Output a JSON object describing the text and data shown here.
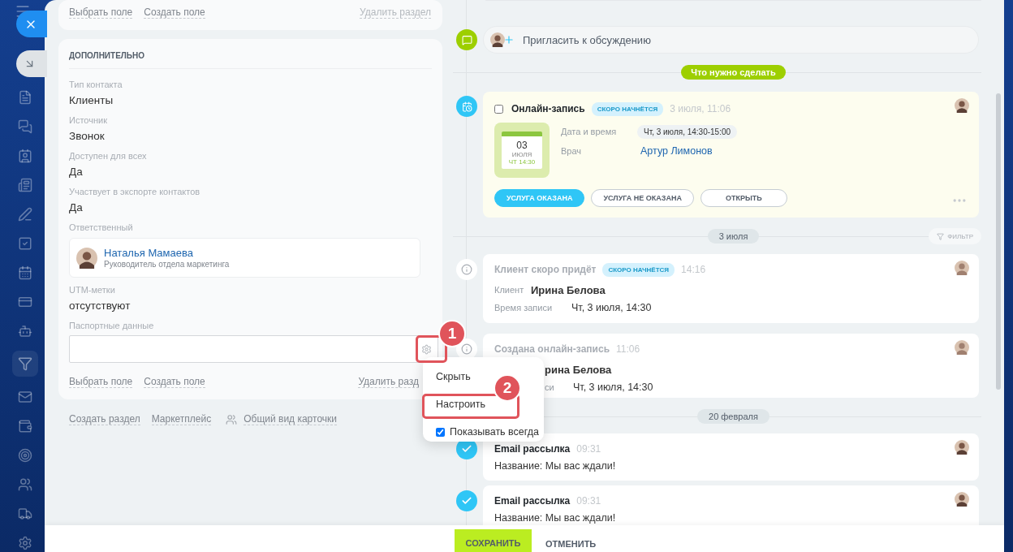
{
  "top_section": {
    "links": [
      "Выбрать поле",
      "Создать поле"
    ],
    "delete_link": "Удалить раздел"
  },
  "section": {
    "title": "ДОПОЛНИТЕЛЬНО",
    "fields": [
      {
        "kind": "text",
        "label": "Тип контакта",
        "value": "Клиенты"
      },
      {
        "kind": "text",
        "label": "Источник",
        "value": "Звонок"
      },
      {
        "kind": "text",
        "label": "Доступен для всех",
        "value": "Да"
      },
      {
        "kind": "text",
        "label": "Участвует в экспорте контактов",
        "value": "Да"
      },
      {
        "kind": "person",
        "label": "Ответственный",
        "name": "Наталья Мамаева",
        "position": "Руководитель отдела маркетинга"
      },
      {
        "kind": "text",
        "label": "UTM-метки",
        "value": "отсутствуют"
      },
      {
        "kind": "input",
        "label": "Паспортные данные"
      }
    ],
    "links": [
      "Выбрать поле",
      "Создать поле"
    ],
    "delete_link": "Удалить разд"
  },
  "footer_links": [
    {
      "kind": "link",
      "label": "Создать раздел"
    },
    {
      "kind": "link",
      "label": "Маркетплейс"
    },
    {
      "kind": "view",
      "label": "Общий вид карточки"
    }
  ],
  "timeline": {
    "invite": "Пригласить к обсуждению",
    "todo_badge": "Что нужно сделать",
    "booking": {
      "checked": false,
      "title": "Онлайн-запись",
      "status": "СКОРО НАЧНЁТСЯ",
      "time": "3 июля, 11:06",
      "calendar": {
        "day": "03",
        "month": "ИЮЛЯ",
        "weekday": "ЧТ 14:30"
      },
      "rows": [
        {
          "kind": "chip",
          "label": "Дата и время",
          "value": "Чт, 3 июля, 14:30-15:00"
        },
        {
          "kind": "link",
          "label": "Врач",
          "value": "Артур Лимонов"
        }
      ],
      "buttons": [
        {
          "label": "УСЛУГА ОКАЗАНА",
          "primary": true
        },
        {
          "label": "УСЛУГА НЕ ОКАЗАНА",
          "primary": false
        },
        {
          "label": "ОТКРЫТЬ",
          "primary": false
        }
      ]
    },
    "history": [
      {
        "kind": "date",
        "label": "3 июля",
        "filter": "ФИЛЬТР"
      },
      {
        "kind": "info",
        "title": "Клиент скоро придёт",
        "status": "СКОРО НАЧНЁТСЯ",
        "time": "14:16",
        "rows": [
          {
            "kind": "full",
            "label": "Клиент",
            "value": "Ирина Белова",
            "strong": true
          },
          {
            "kind": "full",
            "label": "Время записи",
            "value": "Чт, 3 июля, 14:30",
            "strong": false
          }
        ]
      },
      {
        "kind": "info",
        "title": "Создана онлайн-запись",
        "time": "11:06",
        "rows": [
          {
            "kind": "partial",
            "value": "рина Белова",
            "strong": true
          },
          {
            "kind": "partial",
            "label": "си",
            "value": "Чт, 3 июля, 14:30",
            "strong": false
          }
        ]
      },
      {
        "kind": "date",
        "label": "20 февраля"
      },
      {
        "kind": "email",
        "title": "Email рассылка",
        "time": "09:31",
        "text": "Название: Мы вас ждали!"
      },
      {
        "kind": "email",
        "title": "Email рассылка",
        "time": "09:31",
        "text": "Название: Мы вас ждали!"
      }
    ]
  },
  "menu": {
    "items": [
      {
        "kind": "item",
        "label": "Скрыть",
        "highlighted": false
      },
      {
        "kind": "item",
        "label": "Настроить",
        "highlighted": true
      },
      {
        "kind": "checkbox",
        "label": "Показывать всегда",
        "checked": true
      }
    ]
  },
  "annotations": [
    {
      "label": "1"
    },
    {
      "label": "2"
    }
  ],
  "bottom_bar": {
    "save": "СОХРАНИТЬ",
    "cancel": "ОТМЕНИТЬ"
  }
}
